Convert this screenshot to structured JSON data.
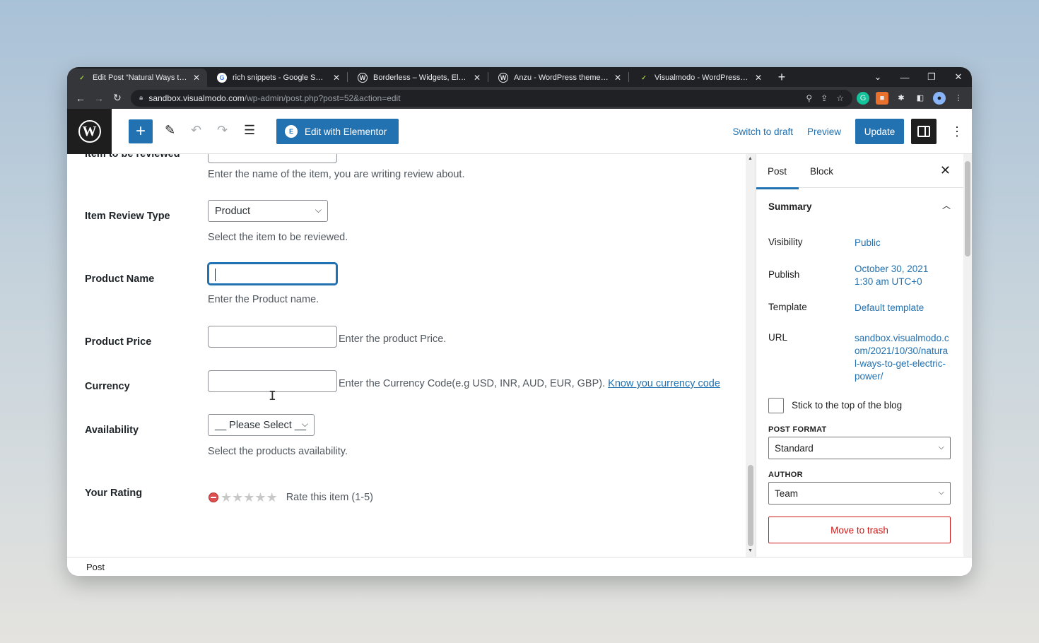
{
  "browser": {
    "tabs": [
      {
        "title": "Edit Post “Natural Ways to Get El",
        "favicon": "visualmodo-icon",
        "active": true
      },
      {
        "title": "rich snippets - Google Search",
        "favicon": "google-icon",
        "active": false
      },
      {
        "title": "Borderless – Widgets, Elements, ",
        "favicon": "wordpress-icon",
        "active": false
      },
      {
        "title": "Anzu - WordPress theme | WordP",
        "favicon": "wordpress-icon",
        "active": false
      },
      {
        "title": "Visualmodo - WordPress Themes",
        "favicon": "visualmodo-icon",
        "active": false
      }
    ],
    "new_tab": "+",
    "url_host": "sandbox.visualmodo.com",
    "url_path": "/wp-admin/post.php?post=52&action=edit"
  },
  "toolbar": {
    "add_block": "+",
    "elementor_label": "Edit with Elementor",
    "switch_to_draft": "Switch to draft",
    "preview": "Preview",
    "update": "Update"
  },
  "form": {
    "partial_label": "Item to be reviewed",
    "item_name_help": "Enter the name of the item, you are writing review about.",
    "review_type": {
      "label": "Item Review Type",
      "value": "Product",
      "help": "Select the item to be reviewed."
    },
    "product_name": {
      "label": "Product Name",
      "value": "",
      "help": "Enter the Product name."
    },
    "product_price": {
      "label": "Product Price",
      "value": "",
      "help": "Enter the product Price."
    },
    "currency": {
      "label": "Currency",
      "value": "",
      "help": "Enter the Currency Code(e.g USD, INR, AUD, EUR, GBP).",
      "link": "Know you currency code"
    },
    "availability": {
      "label": "Availability",
      "value": "__ Please Select __",
      "help": "Select the products availability."
    },
    "rating": {
      "label": "Your Rating",
      "stars": 5,
      "value": 0,
      "help": "Rate this item (1-5)"
    }
  },
  "sidebar": {
    "tabs": [
      "Post",
      "Block"
    ],
    "active_tab": "Post",
    "summary_title": "Summary",
    "visibility_label": "Visibility",
    "visibility_value": "Public",
    "publish_label": "Publish",
    "publish_value_line1": "October 30, 2021",
    "publish_value_line2": "1:30 am UTC+0",
    "template_label": "Template",
    "template_value": "Default template",
    "url_label": "URL",
    "url_value": "sandbox.visualmodo.com/2021/10/30/natural-ways-to-get-electric-power/",
    "sticky_label": "Stick to the top of the blog",
    "sticky_checked": false,
    "post_format_label": "POST FORMAT",
    "post_format_value": "Standard",
    "author_label": "AUTHOR",
    "author_value": "Team",
    "trash_label": "Move to trash"
  },
  "footer": {
    "breadcrumb": "Post"
  },
  "colors": {
    "accent": "#2271b1",
    "danger": "#cc1818",
    "wp_dark": "#1e1e1e"
  }
}
